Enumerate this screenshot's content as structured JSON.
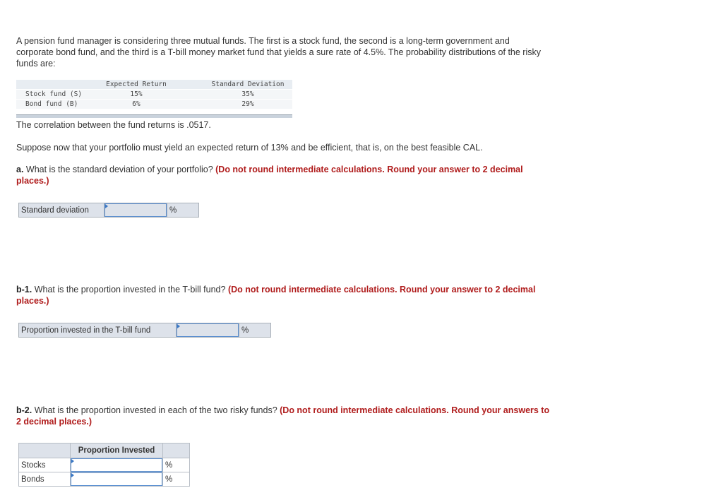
{
  "intro": {
    "line1": "A pension fund manager is considering three mutual funds. The first is a stock fund, the second is a long-term government and",
    "line2": "corporate bond fund, and the third is a T-bill money market fund that yields a sure rate of 4.5%. The probability distributions of the risky",
    "line3": "funds are:"
  },
  "fund_table": {
    "headers": [
      "",
      "Expected Return",
      "Standard Deviation"
    ],
    "rows": [
      {
        "name": "Stock fund (S)",
        "expected_return": "15%",
        "std_dev": "35%"
      },
      {
        "name": "Bond fund (B)",
        "expected_return": "6%",
        "std_dev": "29%"
      }
    ]
  },
  "correlation_text": "The correlation between the fund returns is .0517.",
  "suppose_text": "Suppose now that your portfolio must yield an expected return of 13% and be efficient, that is, on the best feasible CAL.",
  "question_a": {
    "label": "a.",
    "text": " What is the standard deviation of your portfolio? ",
    "instruction_line1": "(Do not round intermediate calculations. Round your answer to 2 decimal",
    "instruction_line2": "places.)",
    "field_label": "Standard deviation",
    "value": "",
    "unit": "%"
  },
  "question_b1": {
    "label": "b-1.",
    "text": " What is the proportion invested in the T-bill fund? ",
    "instruction_line1": "(Do not round intermediate calculations. Round your answer to 2 decimal",
    "instruction_line2": "places.)",
    "field_label": "Proportion invested in the T-bill fund",
    "value": "",
    "unit": "%"
  },
  "question_b2": {
    "label": "b-2.",
    "text": " What is the proportion invested in each of the two risky funds? ",
    "instruction_line1": "(Do not round intermediate calculations. Round your answers to",
    "instruction_line2": "2 decimal places.)",
    "column_header": "Proportion Invested",
    "rows": [
      {
        "label": "Stocks",
        "value": "",
        "unit": "%"
      },
      {
        "label": "Bonds",
        "value": "",
        "unit": "%"
      }
    ]
  }
}
